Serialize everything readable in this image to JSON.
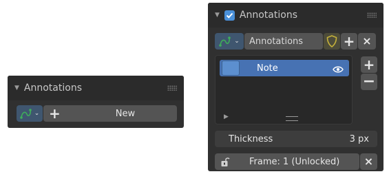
{
  "left_panel": {
    "title": "Annotations",
    "new_label": "New",
    "add_symbol": "+",
    "annotation_icon": "stroke-curve-icon",
    "chevron_icon": "chevron-down-icon"
  },
  "right_panel": {
    "title": "Annotations",
    "enabled": true,
    "datablock_name": "Annotations",
    "add_symbol": "+",
    "remove_symbol": "×",
    "fake_user_icon": "shield-icon",
    "layers": [
      {
        "name": "Note",
        "color": "#5c8fcf",
        "visible": true,
        "selected": true
      }
    ],
    "layer_add_symbol": "+",
    "layer_remove_symbol": "−",
    "thickness_label": "Thickness",
    "thickness_value": "3 px",
    "frame_label": "Frame: 1 (Unlocked)",
    "frame_clear_symbol": "×"
  },
  "colors": {
    "panel_bg": "#303030",
    "header_bg": "#2b2b2b",
    "widget_bg": "#545454",
    "list_bg": "#282828",
    "selected_row": "#4772b3",
    "checkbox_accent": "#4a90d9",
    "icon_green": "#3fae5a",
    "shield_yellow": "#c6b23a"
  }
}
